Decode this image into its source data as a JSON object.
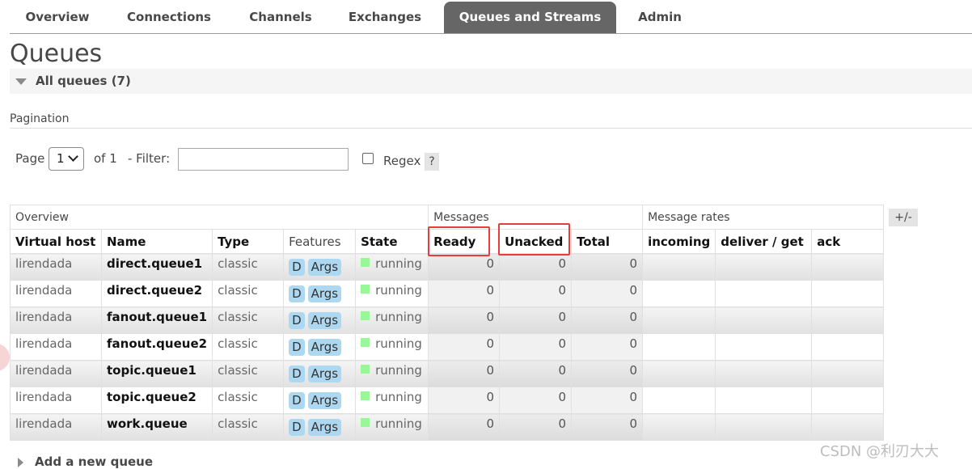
{
  "tabs": [
    {
      "label": "Overview"
    },
    {
      "label": "Connections"
    },
    {
      "label": "Channels"
    },
    {
      "label": "Exchanges"
    },
    {
      "label": "Queues and Streams"
    },
    {
      "label": "Admin"
    }
  ],
  "page_title": "Queues",
  "section_title": "All queues (7)",
  "pagination": {
    "label": "Pagination",
    "page_label": "Page",
    "page_value": "1",
    "of_label": "of 1",
    "filter_label": "- Filter:",
    "filter_value": "",
    "regex_label": "Regex",
    "help_label": "?"
  },
  "table": {
    "groups": [
      "Overview",
      "Messages",
      "Message rates"
    ],
    "columns": [
      "Virtual host",
      "Name",
      "Type",
      "Features",
      "State",
      "Ready",
      "Unacked",
      "Total",
      "incoming",
      "deliver / get",
      "ack"
    ],
    "toggle_label": "+/-",
    "rows": [
      {
        "vhost": "lirendada",
        "name": "direct.queue1",
        "type": "classic",
        "feature_d": "D",
        "feature_args": "Args",
        "state": "running",
        "ready": "0",
        "unacked": "0",
        "total": "0"
      },
      {
        "vhost": "lirendada",
        "name": "direct.queue2",
        "type": "classic",
        "feature_d": "D",
        "feature_args": "Args",
        "state": "running",
        "ready": "0",
        "unacked": "0",
        "total": "0"
      },
      {
        "vhost": "lirendada",
        "name": "fanout.queue1",
        "type": "classic",
        "feature_d": "D",
        "feature_args": "Args",
        "state": "running",
        "ready": "0",
        "unacked": "0",
        "total": "0"
      },
      {
        "vhost": "lirendada",
        "name": "fanout.queue2",
        "type": "classic",
        "feature_d": "D",
        "feature_args": "Args",
        "state": "running",
        "ready": "0",
        "unacked": "0",
        "total": "0"
      },
      {
        "vhost": "lirendada",
        "name": "topic.queue1",
        "type": "classic",
        "feature_d": "D",
        "feature_args": "Args",
        "state": "running",
        "ready": "0",
        "unacked": "0",
        "total": "0"
      },
      {
        "vhost": "lirendada",
        "name": "topic.queue2",
        "type": "classic",
        "feature_d": "D",
        "feature_args": "Args",
        "state": "running",
        "ready": "0",
        "unacked": "0",
        "total": "0"
      },
      {
        "vhost": "lirendada",
        "name": "work.queue",
        "type": "classic",
        "feature_d": "D",
        "feature_args": "Args",
        "state": "running",
        "ready": "0",
        "unacked": "0",
        "total": "0"
      }
    ]
  },
  "add_queue_label": "Add a new queue",
  "watermark": "CSDN @利刃大大",
  "colors": {
    "active_tab": "#666666",
    "feature_badge": "#add8f2",
    "running": "#98f898",
    "highlight": "#e53e3e"
  }
}
